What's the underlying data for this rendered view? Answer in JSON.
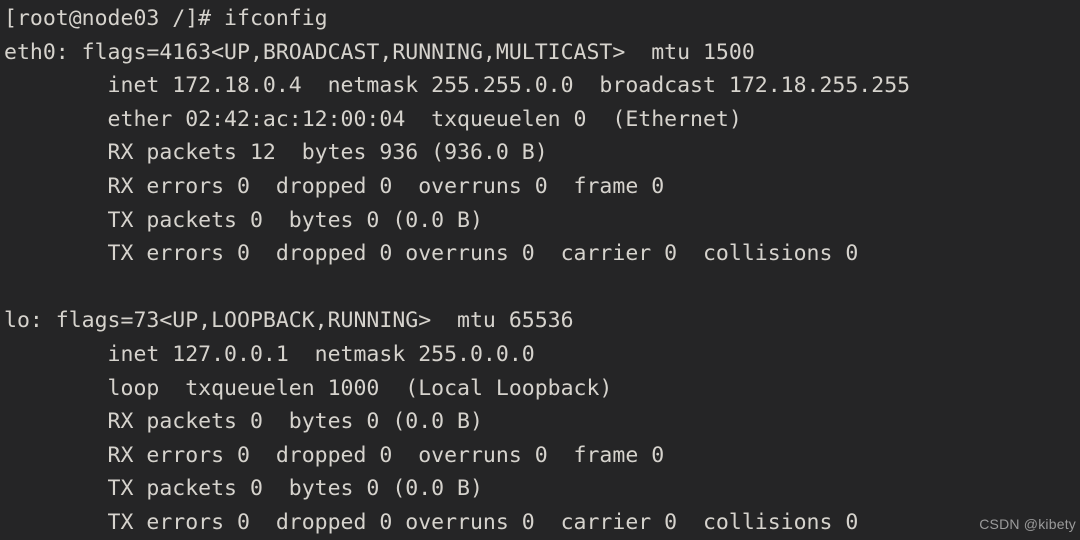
{
  "terminal": {
    "background_color": "#252526",
    "foreground_color": "#d6d3cd",
    "prompt": "[root@node03 /]#",
    "command": "ifconfig",
    "lines": [
      "[root@node03 /]# ifconfig",
      "eth0: flags=4163<UP,BROADCAST,RUNNING,MULTICAST>  mtu 1500",
      "        inet 172.18.0.4  netmask 255.255.0.0  broadcast 172.18.255.255",
      "        ether 02:42:ac:12:00:04  txqueuelen 0  (Ethernet)",
      "        RX packets 12  bytes 936 (936.0 B)",
      "        RX errors 0  dropped 0  overruns 0  frame 0",
      "        TX packets 0  bytes 0 (0.0 B)",
      "        TX errors 0  dropped 0 overruns 0  carrier 0  collisions 0",
      "",
      "lo: flags=73<UP,LOOPBACK,RUNNING>  mtu 65536",
      "        inet 127.0.0.1  netmask 255.0.0.0",
      "        loop  txqueuelen 1000  (Local Loopback)",
      "        RX packets 0  bytes 0 (0.0 B)",
      "        RX errors 0  dropped 0  overruns 0  frame 0",
      "        TX packets 0  bytes 0 (0.0 B)",
      "        TX errors 0  dropped 0 overruns 0  carrier 0  collisions 0"
    ],
    "interfaces": [
      {
        "name": "eth0",
        "flags": "4163<UP,BROADCAST,RUNNING,MULTICAST>",
        "mtu": "1500",
        "inet": "172.18.0.4",
        "netmask": "255.255.0.0",
        "broadcast": "172.18.255.255",
        "ether": "02:42:ac:12:00:04",
        "txqueuelen": "0",
        "link_type": "(Ethernet)",
        "rx_packets": "12",
        "rx_bytes": "936",
        "rx_bytes_human": "(936.0 B)",
        "rx_errors": "0",
        "rx_dropped": "0",
        "rx_overruns": "0",
        "rx_frame": "0",
        "tx_packets": "0",
        "tx_bytes": "0",
        "tx_bytes_human": "(0.0 B)",
        "tx_errors": "0",
        "tx_dropped": "0",
        "tx_overruns": "0",
        "tx_carrier": "0",
        "tx_collisions": "0"
      },
      {
        "name": "lo",
        "flags": "73<UP,LOOPBACK,RUNNING>",
        "mtu": "65536",
        "inet": "127.0.0.1",
        "netmask": "255.0.0.0",
        "link_type": "(Local Loopback)",
        "loop": "loop",
        "txqueuelen": "1000",
        "rx_packets": "0",
        "rx_bytes": "0",
        "rx_bytes_human": "(0.0 B)",
        "rx_errors": "0",
        "rx_dropped": "0",
        "rx_overruns": "0",
        "rx_frame": "0",
        "tx_packets": "0",
        "tx_bytes": "0",
        "tx_bytes_human": "(0.0 B)",
        "tx_errors": "0",
        "tx_dropped": "0",
        "tx_overruns": "0",
        "tx_carrier": "0",
        "tx_collisions": "0"
      }
    ]
  },
  "watermark": {
    "text": "CSDN @kibety",
    "color": "#9b9b9b"
  }
}
